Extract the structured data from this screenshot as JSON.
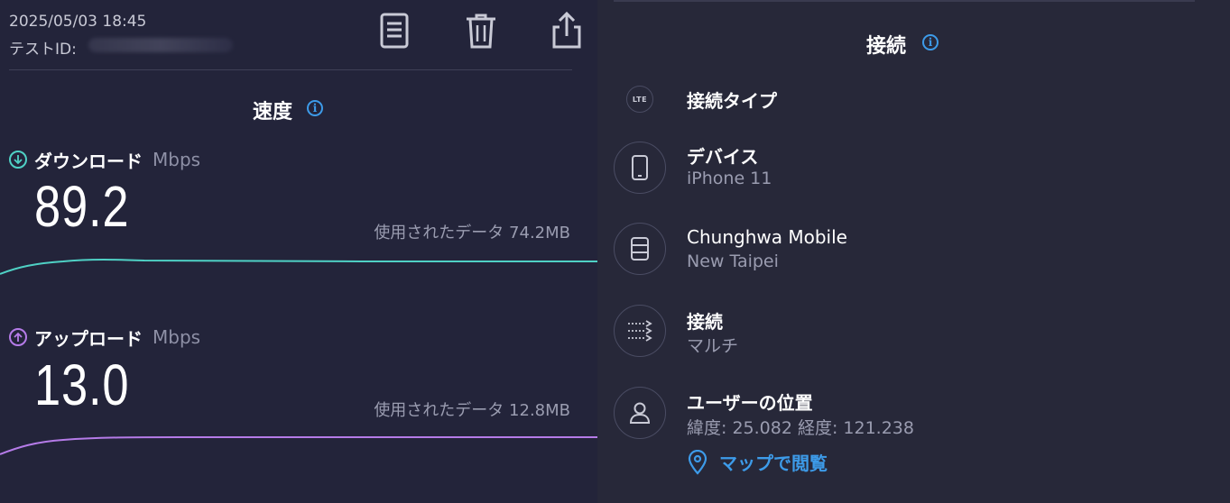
{
  "header": {
    "datetime": "2025/05/03 18:45",
    "test_id_label": "テストID:",
    "icons": [
      "notes-icon",
      "trash-icon",
      "share-icon"
    ]
  },
  "speed": {
    "title": "速度",
    "download": {
      "label": "ダウンロード",
      "unit": "Mbps",
      "value": "89.2",
      "used_data": "使用されたデータ 74.2MB",
      "color": "#4fd1c5"
    },
    "upload": {
      "label": "アップロード",
      "unit": "Mbps",
      "value": "13.0",
      "used_data": "使用されたデータ 12.8MB",
      "color": "#b57be8"
    }
  },
  "connection": {
    "title": "接続",
    "rows": [
      {
        "icon": "lte-icon",
        "title": "接続タイプ",
        "sub": ""
      },
      {
        "icon": "phone-icon",
        "title": "デバイス",
        "sub": "iPhone 11"
      },
      {
        "icon": "server-icon",
        "title": "Chunghwa Mobile",
        "sub": "New Taipei"
      },
      {
        "icon": "multi-connection-icon",
        "title": "接続",
        "sub": "マルチ"
      },
      {
        "icon": "user-icon",
        "title": "ユーザーの位置",
        "sub": "緯度: 25.082  経度: 121.238"
      }
    ],
    "lte_badge": "LTE",
    "map_link": "マップで閲覧"
  },
  "colors": {
    "background": "#23243a",
    "accent": "#3d9be9",
    "download": "#4fd1c5",
    "upload": "#b57be8"
  }
}
